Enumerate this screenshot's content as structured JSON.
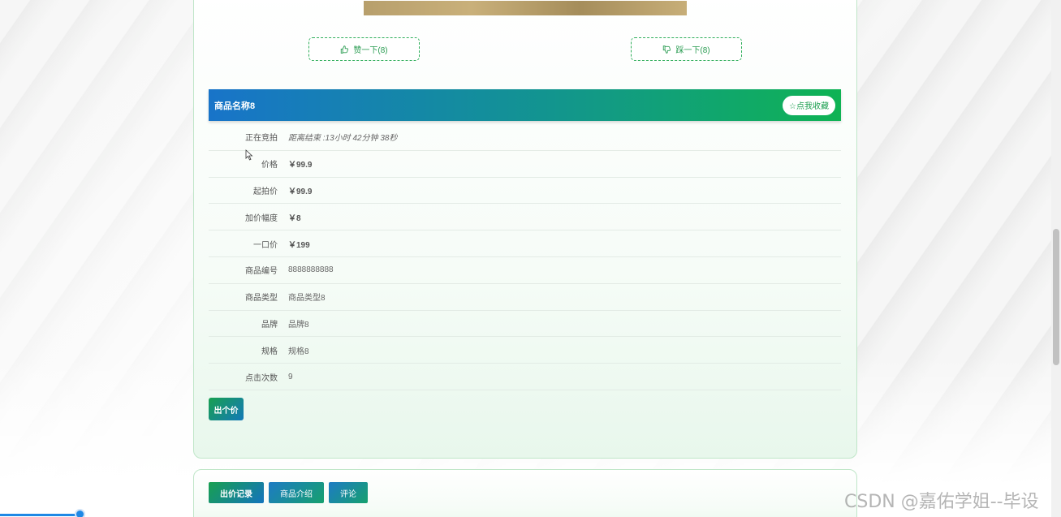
{
  "votes": {
    "like_label": "赞一下(8)",
    "dislike_label": "踩一下(8)"
  },
  "product": {
    "name": "商品名称8",
    "favorite_label": "☆点我收藏"
  },
  "info_rows": [
    {
      "label": "正在竞拍",
      "value": "距离结束 :13小时 42分钟 38秒"
    },
    {
      "label": "价格",
      "value": "￥99.9"
    },
    {
      "label": "起拍价",
      "value": "￥99.9"
    },
    {
      "label": "加价幅度",
      "value": "￥8"
    },
    {
      "label": "一口价",
      "value": "￥199"
    },
    {
      "label": "商品编号",
      "value": "8888888888"
    },
    {
      "label": "商品类型",
      "value": "商品类型8"
    },
    {
      "label": "品牌",
      "value": "品牌8"
    },
    {
      "label": "规格",
      "value": "规格8"
    },
    {
      "label": "点击次数",
      "value": "9"
    }
  ],
  "bid_button": "出个价",
  "tabs": [
    {
      "label": "出价记录"
    },
    {
      "label": "商品介绍"
    },
    {
      "label": "评论"
    }
  ],
  "watermark": "CSDN @嘉佑学姐--毕设",
  "colors": {
    "accent_green": "#0fb354",
    "accent_blue": "#1874c9"
  }
}
